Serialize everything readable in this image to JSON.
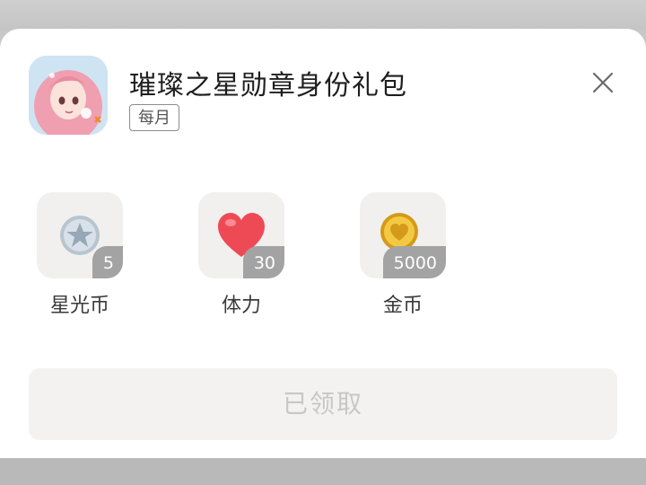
{
  "package": {
    "title": "璀璨之星勋章身份礼包",
    "frequency_tag": "每月"
  },
  "rewards": [
    {
      "label": "星光币",
      "quantity": "5",
      "icon": "silver-star-coin-icon"
    },
    {
      "label": "体力",
      "quantity": "30",
      "icon": "heart-icon"
    },
    {
      "label": "金币",
      "quantity": "5000",
      "icon": "gold-coin-icon"
    }
  ],
  "claim_button": {
    "label": "已领取",
    "state": "disabled"
  },
  "colors": {
    "sheet_background": "#ffffff",
    "tile_background": "#f1f0ef",
    "quantity_badge": "#a3a3a3",
    "disabled_button": "#f4f2f1",
    "disabled_text": "#c9c7c6"
  }
}
